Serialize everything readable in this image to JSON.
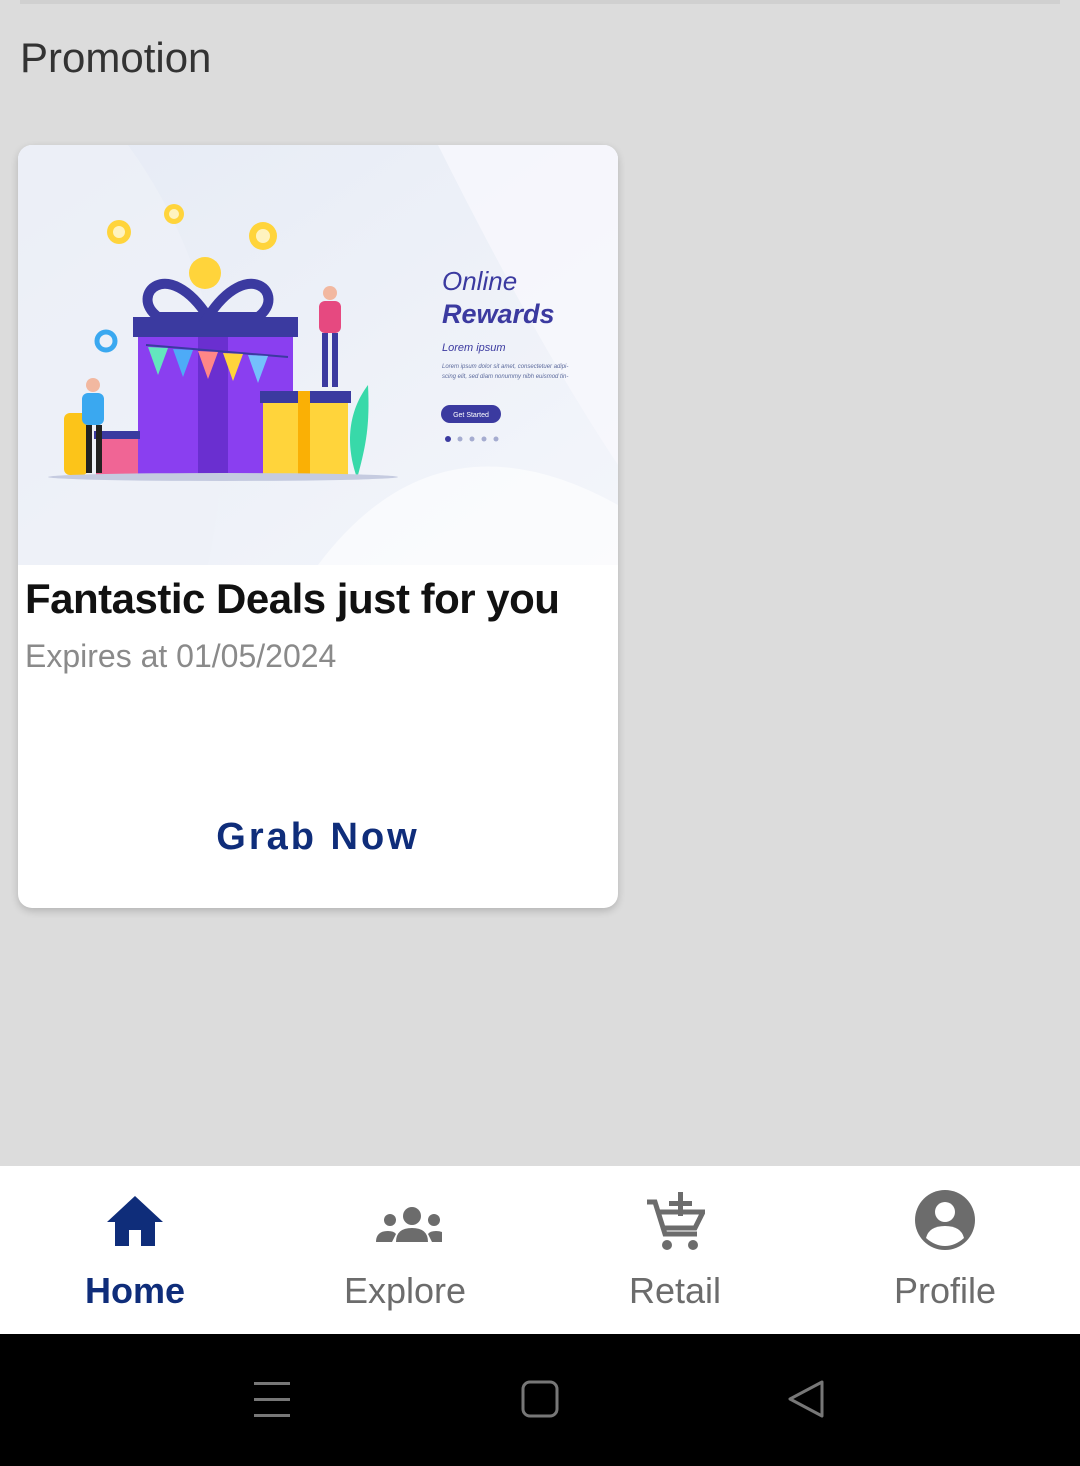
{
  "section": {
    "title": "Promotion"
  },
  "promo": {
    "title": "Fantastic Deals just for you",
    "expiry": "Expires at 01/05/2024",
    "button_label": "Grab Now",
    "illustration": {
      "heading_line1": "Online",
      "heading_line2": "Rewards",
      "subheading": "Lorem ipsum",
      "body_line1": "Lorem ipsum dolor sit amet, consectetuer adipi-",
      "body_line2": "scing elit, sed diam nonummy nibh euismod tin-",
      "cta_label": "Get Started"
    }
  },
  "nav": {
    "items": [
      {
        "label": "Home",
        "icon": "home-icon",
        "active": true
      },
      {
        "label": "Explore",
        "icon": "group-icon",
        "active": false
      },
      {
        "label": "Retail",
        "icon": "add-cart-icon",
        "active": false
      },
      {
        "label": "Profile",
        "icon": "account-circle-icon",
        "active": false
      }
    ]
  },
  "colors": {
    "accent": "#0f2d7a",
    "nav_inactive": "#6c6c6c",
    "background": "#dcdcdc"
  }
}
